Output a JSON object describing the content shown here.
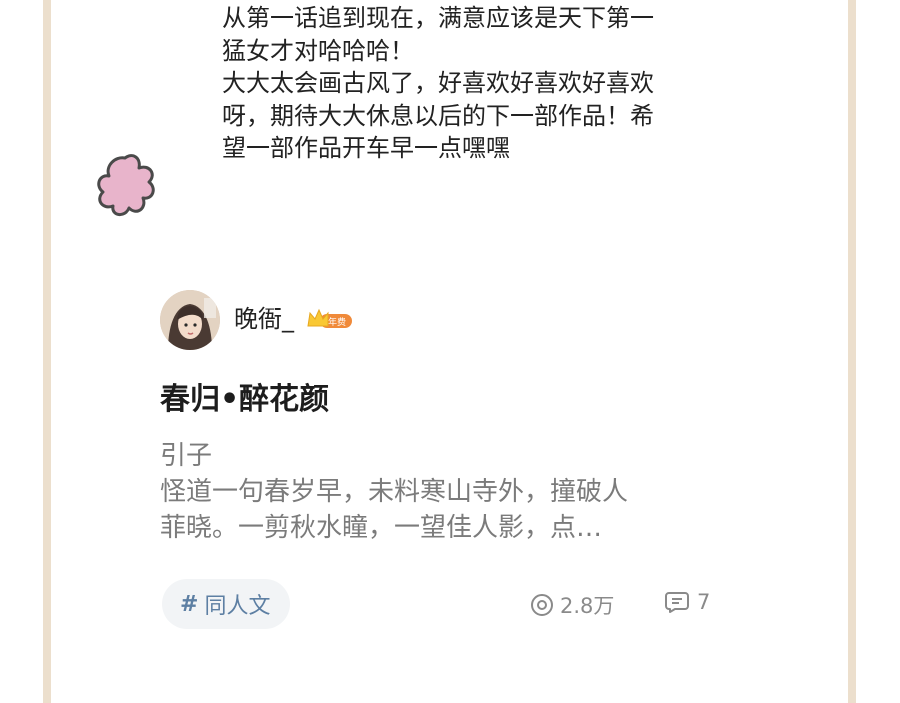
{
  "comment": {
    "lines": [
      "从第一话追到现在，满意应该是天下第一",
      "猛女才对哈哈哈！",
      "大大太会画古风了，好喜欢好喜欢好喜欢",
      "呀，期待大大休息以后的下一部作品！希",
      "望一部作品开车早一点嘿嘿"
    ]
  },
  "post": {
    "author": {
      "name": "晚衙_",
      "badge": "年费"
    },
    "title": "春归•醉花颜",
    "excerpt_lines": [
      "引子",
      " 怪道一句春岁早，未料寒山寺外，撞破人",
      "菲晓。一剪秋水瞳，一望佳人影，点…"
    ],
    "tag": {
      "icon": "hash-icon",
      "label": "同人文"
    },
    "stats": {
      "views": "2.8万",
      "comments": "7"
    }
  },
  "colors": {
    "frame": "#ecdfcd",
    "flower": "#e8b4cb",
    "tag_text": "#5d7fa3",
    "badge": "#f08a3a"
  }
}
